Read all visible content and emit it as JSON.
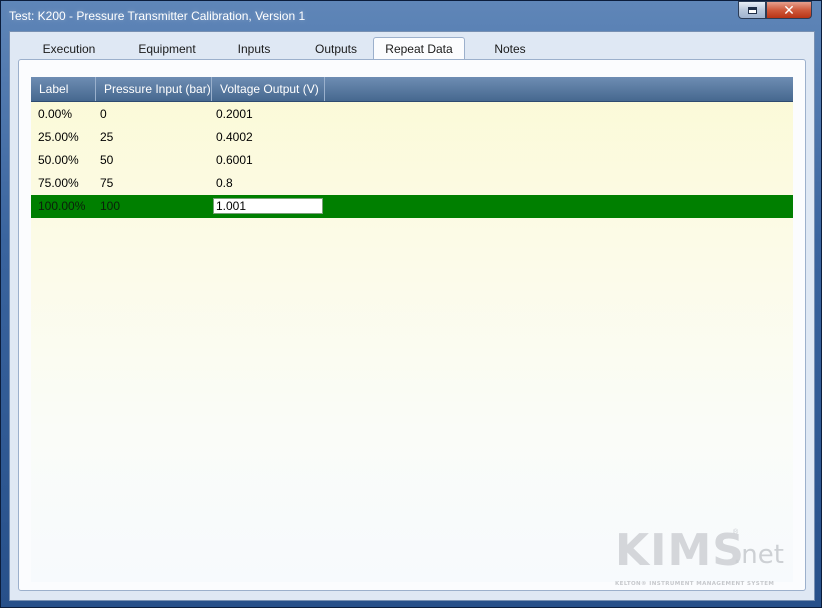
{
  "window": {
    "title": "Test: K200 - Pressure Transmitter Calibration, Version 1",
    "restore_icon": "restore-icon",
    "close_icon": "close-icon",
    "close_glyph": "✕"
  },
  "tabs": [
    {
      "label": "Execution",
      "active": false
    },
    {
      "label": "Equipment",
      "active": false
    },
    {
      "label": "Inputs",
      "active": false
    },
    {
      "label": "Outputs",
      "active": false
    },
    {
      "label": "Repeat Data",
      "active": true
    },
    {
      "label": "Notes",
      "active": false
    }
  ],
  "grid": {
    "columns": [
      "Label",
      "Pressure Input (bar)",
      "Voltage Output (V)"
    ],
    "rows": [
      {
        "label": "0.00%",
        "pressure": "0",
        "voltage": "0.2001"
      },
      {
        "label": "25.00%",
        "pressure": "25",
        "voltage": "0.4002"
      },
      {
        "label": "50.00%",
        "pressure": "50",
        "voltage": "0.6001"
      },
      {
        "label": "75.00%",
        "pressure": "75",
        "voltage": "0.8"
      },
      {
        "label": "100.00%",
        "pressure": "100",
        "voltage": "1.001",
        "selected": true,
        "editing": true
      }
    ]
  },
  "logo": {
    "main": "KIMS",
    "suffix": ".net",
    "tm": "®",
    "tagline": "KELTON® INSTRUMENT MANAGEMENT SYSTEM"
  },
  "colors": {
    "selected_row": "#007f00",
    "header": "#46688f",
    "grid_bg": "#fbf9d6"
  }
}
